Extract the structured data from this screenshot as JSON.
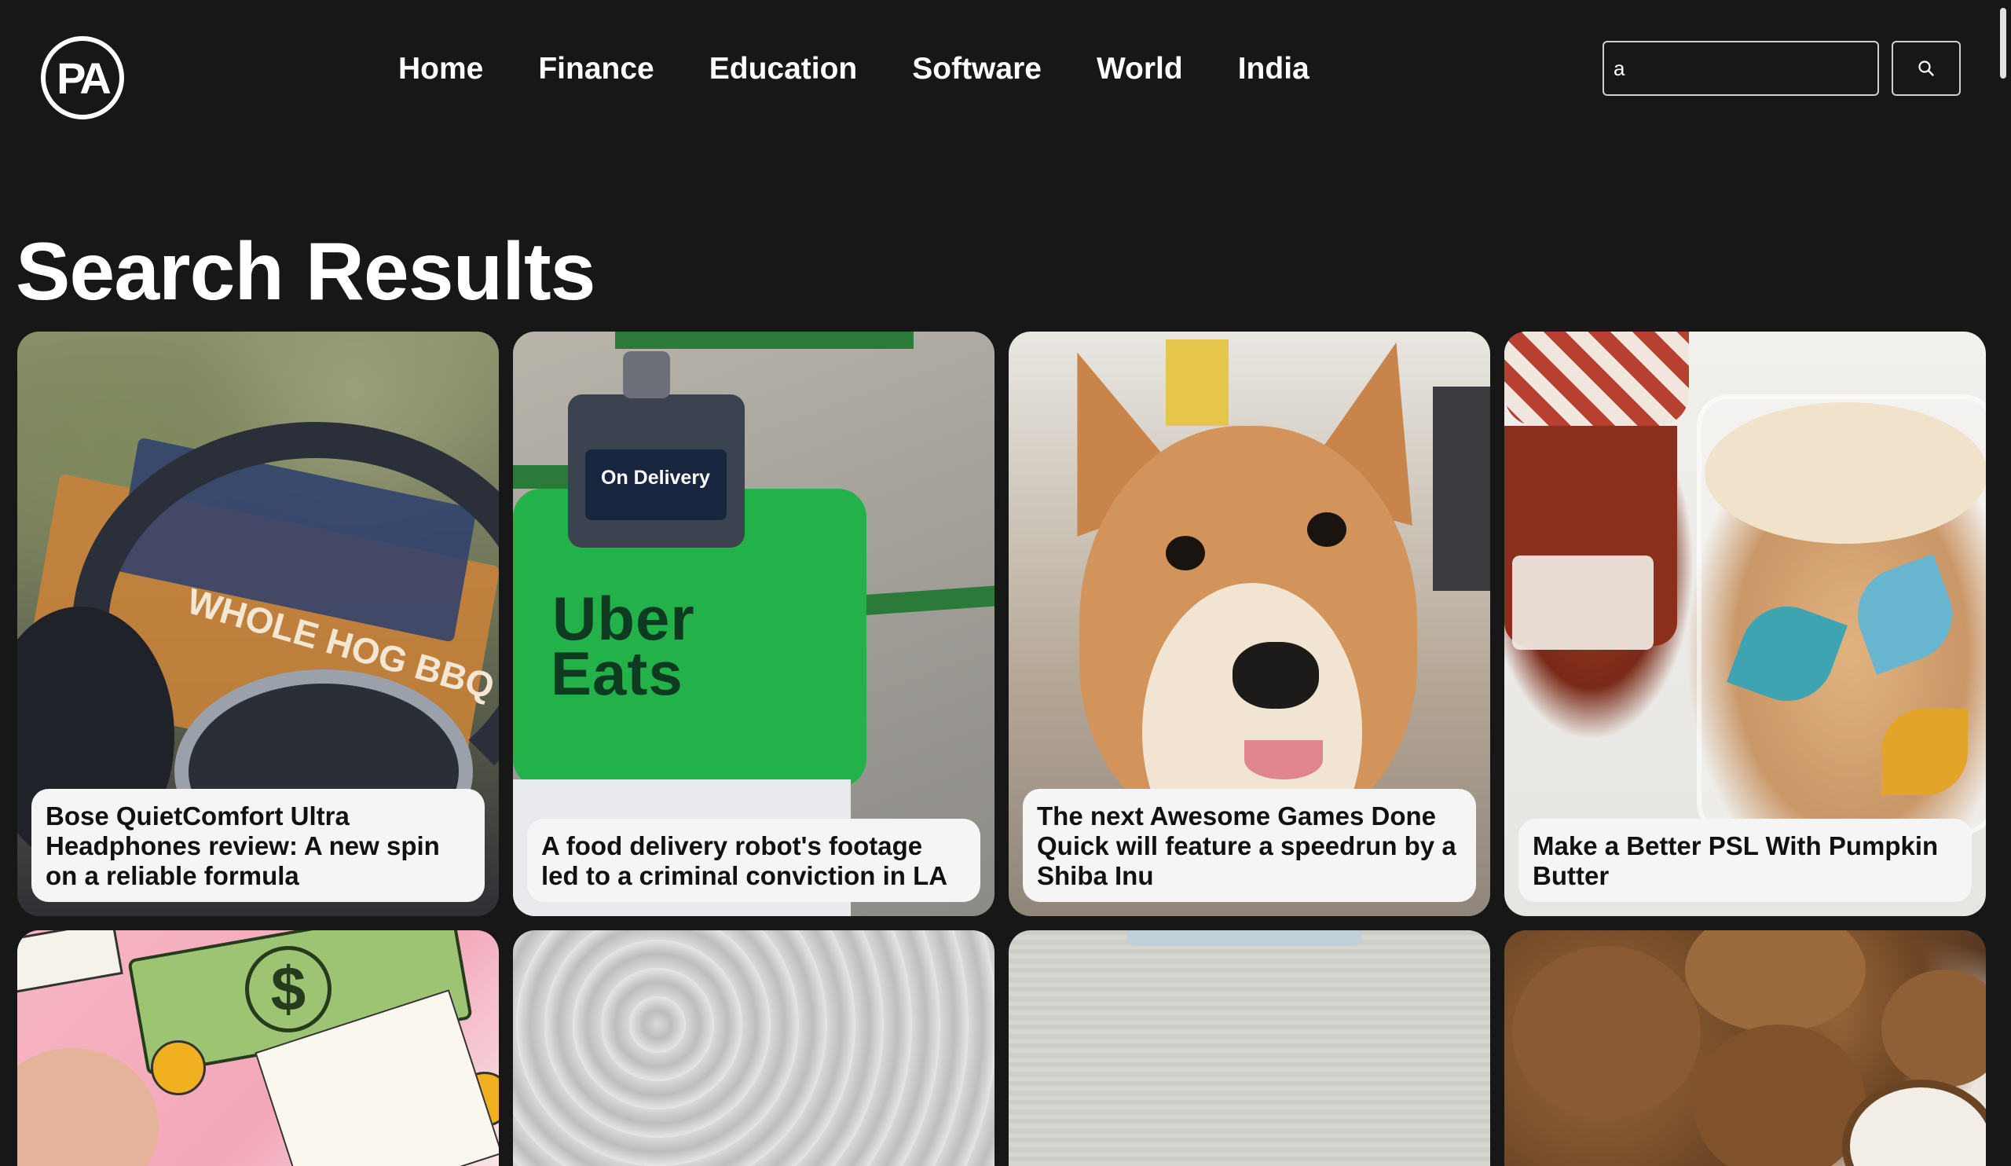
{
  "header": {
    "logo_text": "PA",
    "nav": [
      "Home",
      "Finance",
      "Education",
      "Software",
      "World",
      "India"
    ],
    "search": {
      "value": "a",
      "placeholder": ""
    },
    "search_button_icon": "search-icon"
  },
  "main": {
    "title": "Search Results",
    "cards": [
      {
        "caption": "Bose QuietComfort Ultra Headphones review: A new spin on a reliable formula"
      },
      {
        "caption": "A food delivery robot's footage led to a criminal conviction in LA"
      },
      {
        "caption": "The next Awesome Games Done Quick will feature a speedrun by a Shiba Inu"
      },
      {
        "caption": "Make a Better PSL With Pumpkin Butter"
      }
    ],
    "image_text": {
      "robot_screen": "On Delivery",
      "robot_brand_line1": "Uber",
      "robot_brand_line2": "Eats",
      "box_text": "WHOLE HOG BBQ"
    }
  }
}
